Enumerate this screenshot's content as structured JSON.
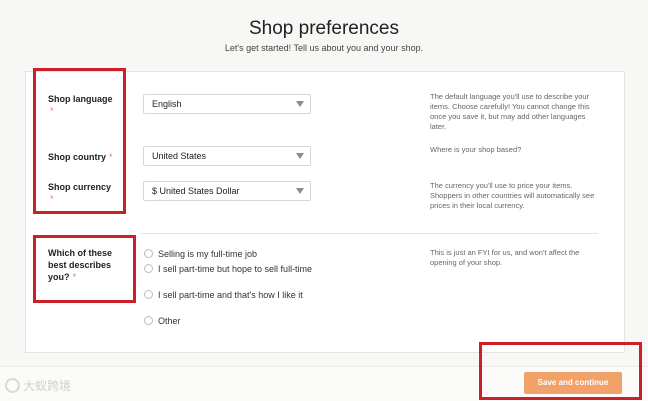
{
  "header": {
    "title": "Shop preferences",
    "subtitle": "Let's get started! Tell us about you and your shop."
  },
  "form": {
    "shop_language": {
      "label": "Shop language",
      "required_mark": "*",
      "value": "English",
      "help": "The default language you'll use to describe your items. Choose carefully! You cannot change this once you save it, but may add other languages later."
    },
    "shop_country": {
      "label": "Shop country",
      "required_mark": "*",
      "value": "United States",
      "help": "Where is your shop based?"
    },
    "shop_currency": {
      "label": "Shop currency",
      "required_mark": "*",
      "value": "$ United States Dollar",
      "help": "The currency you'll use to price your items. Shoppers in other countries will automatically see prices in their local currency."
    },
    "describes_you": {
      "label": "Which of these best describes you?",
      "required_mark": "*",
      "help": "This is just an FYI for us, and won't affect the opening of your shop.",
      "options": [
        "Selling is my full-time job",
        "I sell part-time but hope to sell full-time",
        "I sell part-time and that's how I like it",
        "Other"
      ]
    }
  },
  "footer": {
    "save_label": "Save and continue",
    "watermark": "大蚁跨境"
  },
  "colors": {
    "accent_button": "#f1a26b",
    "annotation_red": "#cc1f2a",
    "required_mark": "#e07a5f"
  }
}
